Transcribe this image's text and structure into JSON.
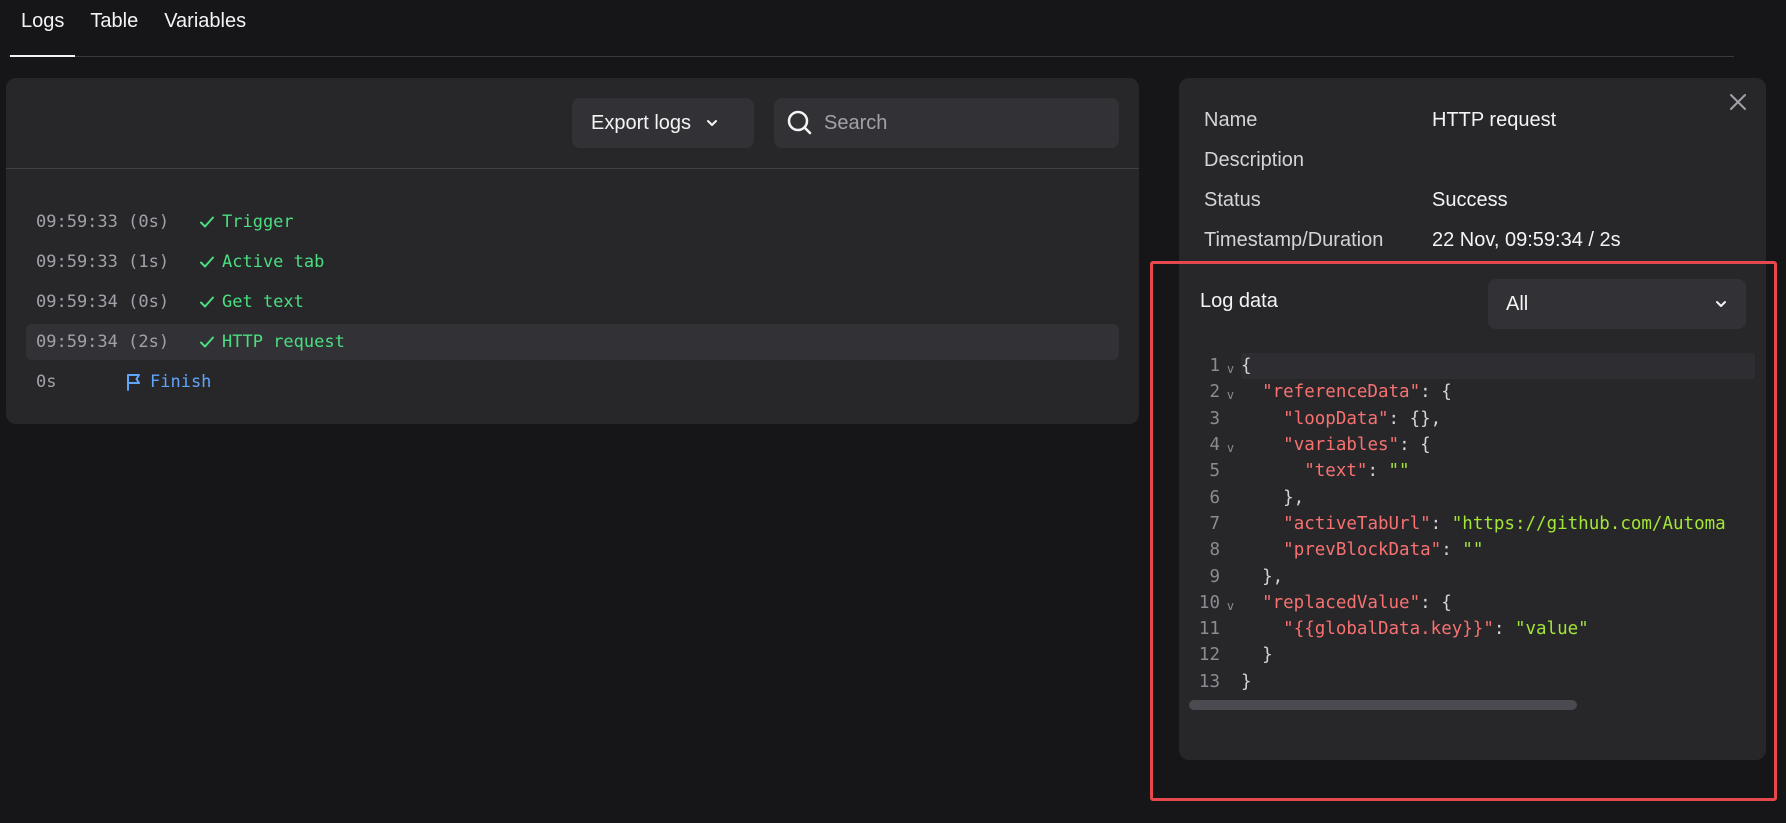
{
  "tabs": [
    {
      "label": "Logs",
      "active": true
    },
    {
      "label": "Table",
      "active": false
    },
    {
      "label": "Variables",
      "active": false
    }
  ],
  "toolbar": {
    "export_label": "Export logs",
    "search_placeholder": "Search"
  },
  "logs": [
    {
      "time": "09:59:33 (0s)",
      "name": "Trigger",
      "status": "success"
    },
    {
      "time": "09:59:33 (1s)",
      "name": "Active tab",
      "status": "success"
    },
    {
      "time": "09:59:34 (0s)",
      "name": "Get text",
      "status": "success"
    },
    {
      "time": "09:59:34 (2s)",
      "name": "HTTP request",
      "status": "success",
      "selected": true
    },
    {
      "time": "0s",
      "name": "Finish",
      "status": "finish"
    }
  ],
  "details": {
    "name_label": "Name",
    "name_value": "HTTP request",
    "description_label": "Description",
    "description_value": "",
    "status_label": "Status",
    "status_value": "Success",
    "timestamp_label": "Timestamp/Duration",
    "timestamp_value": "22 Nov, 09:59:34 / 2s"
  },
  "log_data": {
    "title": "Log data",
    "filter_value": "All"
  },
  "code_lines": [
    {
      "n": "1",
      "fold": true,
      "tokens": [
        [
          "p",
          "{"
        ]
      ]
    },
    {
      "n": "2",
      "fold": true,
      "tokens": [
        [
          "p",
          "  "
        ],
        [
          "k",
          "\"referenceData\""
        ],
        [
          "p",
          ": {"
        ]
      ]
    },
    {
      "n": "3",
      "fold": false,
      "tokens": [
        [
          "p",
          "    "
        ],
        [
          "k",
          "\"loopData\""
        ],
        [
          "p",
          ": {},"
        ]
      ]
    },
    {
      "n": "4",
      "fold": true,
      "tokens": [
        [
          "p",
          "    "
        ],
        [
          "k",
          "\"variables\""
        ],
        [
          "p",
          ": {"
        ]
      ]
    },
    {
      "n": "5",
      "fold": false,
      "tokens": [
        [
          "p",
          "      "
        ],
        [
          "k",
          "\"text\""
        ],
        [
          "p",
          ": "
        ],
        [
          "s",
          "\"\""
        ]
      ]
    },
    {
      "n": "6",
      "fold": false,
      "tokens": [
        [
          "p",
          "    },"
        ]
      ]
    },
    {
      "n": "7",
      "fold": false,
      "tokens": [
        [
          "p",
          "    "
        ],
        [
          "k",
          "\"activeTabUrl\""
        ],
        [
          "p",
          ": "
        ],
        [
          "s",
          "\"https://github.com/Automa"
        ]
      ]
    },
    {
      "n": "8",
      "fold": false,
      "tokens": [
        [
          "p",
          "    "
        ],
        [
          "k",
          "\"prevBlockData\""
        ],
        [
          "p",
          ": "
        ],
        [
          "s",
          "\"\""
        ]
      ]
    },
    {
      "n": "9",
      "fold": false,
      "tokens": [
        [
          "p",
          "  },"
        ]
      ]
    },
    {
      "n": "10",
      "fold": true,
      "tokens": [
        [
          "p",
          "  "
        ],
        [
          "k",
          "\"replacedValue\""
        ],
        [
          "p",
          ": {"
        ]
      ]
    },
    {
      "n": "11",
      "fold": false,
      "tokens": [
        [
          "p",
          "    "
        ],
        [
          "k",
          "\"{{globalData.key}}\""
        ],
        [
          "p",
          ": "
        ],
        [
          "s",
          "\"value\""
        ]
      ]
    },
    {
      "n": "12",
      "fold": false,
      "tokens": [
        [
          "p",
          "  }"
        ]
      ]
    },
    {
      "n": "13",
      "fold": false,
      "tokens": [
        [
          "p",
          "}"
        ]
      ]
    }
  ],
  "colors": {
    "success": "#4ade80",
    "finish": "#60a5fa",
    "json_key": "#f87171",
    "json_string": "#a3e635",
    "highlight": "#e5484d"
  }
}
